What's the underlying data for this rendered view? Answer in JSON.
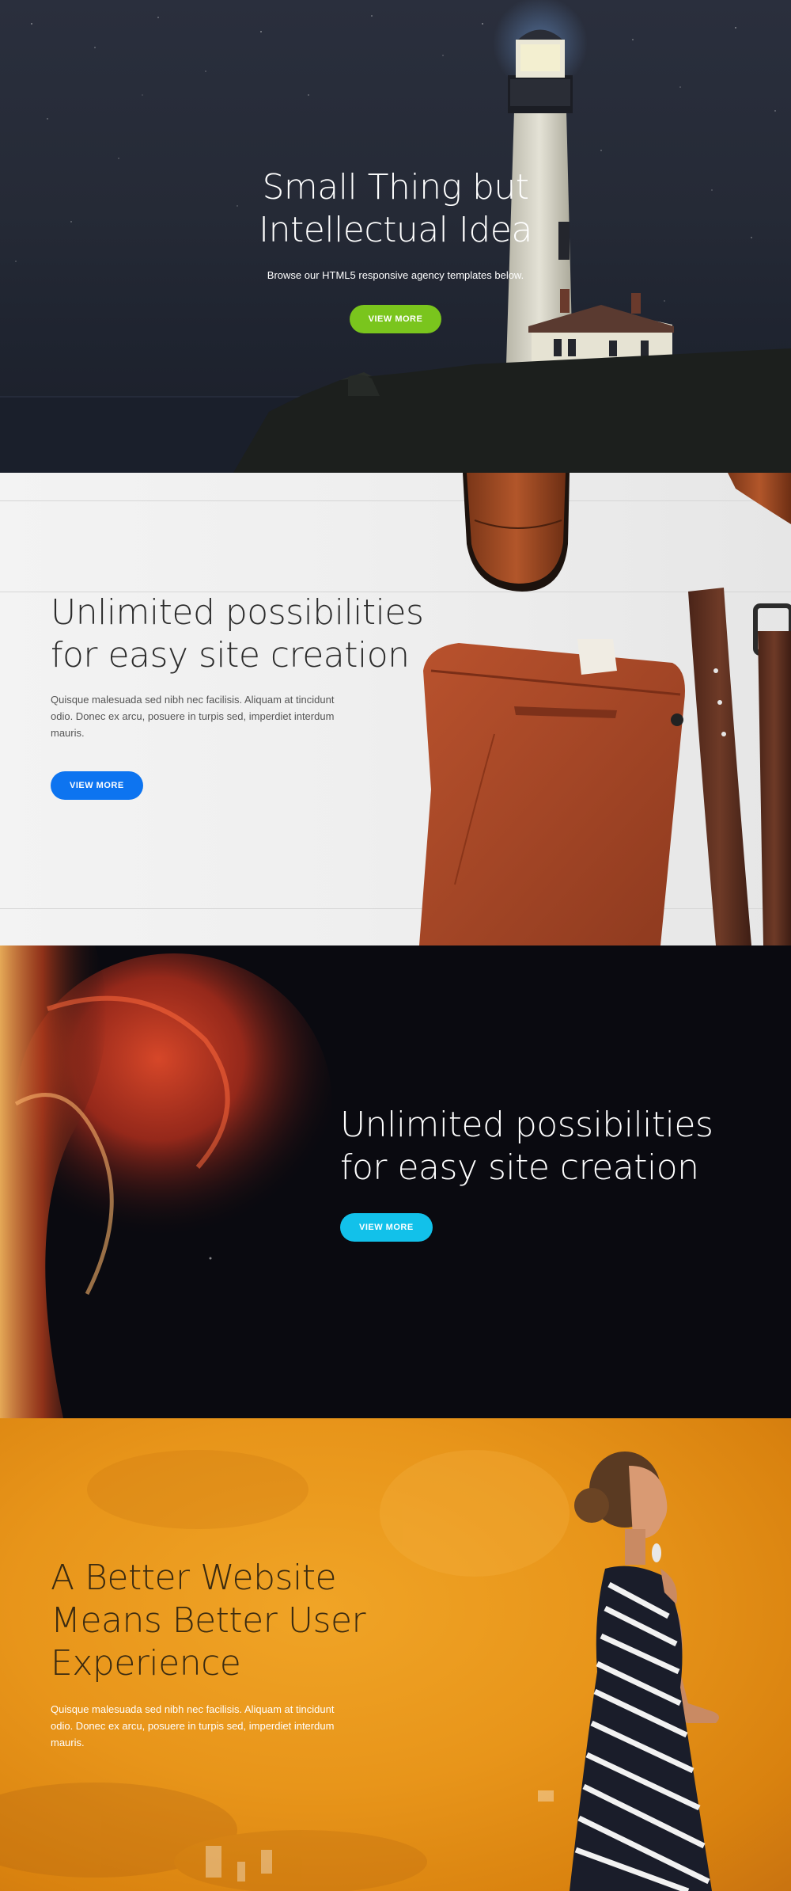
{
  "hero": {
    "title_line1": "Small Thing but",
    "title_line2": "Intellectual Idea",
    "subtitle": "Browse our HTML5 responsive agency templates below.",
    "button_label": "VIEW MORE",
    "button_color": "#7ac51d"
  },
  "feature_light": {
    "title_line1": "Unlimited possibilities",
    "title_line2": "for easy site creation",
    "paragraph": "Quisque malesuada sed nibh nec facilisis. Aliquam at tincidunt odio. Donec ex arcu, posuere in turpis sed, imperdiet interdum mauris.",
    "button_label": "VIEW MORE",
    "button_color": "#0d74f0"
  },
  "feature_dark": {
    "title_line1": "Unlimited possibilities",
    "title_line2": "for easy site creation",
    "button_label": "VIEW MORE",
    "button_color": "#12c1ea"
  },
  "feature_orange": {
    "title_line1": "A Better Website",
    "title_line2": "Means Better User",
    "title_line3": "Experience",
    "paragraph": "Quisque malesuada sed nibh nec facilisis. Aliquam at tincidunt odio. Donec ex arcu, posuere in turpis sed, imperdiet interdum mauris."
  },
  "images": {
    "hero_background": "lighthouse-night-photo",
    "feature_light_background": "shoes-pants-belt-photo",
    "feature_dark_background": "red-smoke-photo",
    "feature_orange_background": "woman-orange-wall-photo"
  }
}
